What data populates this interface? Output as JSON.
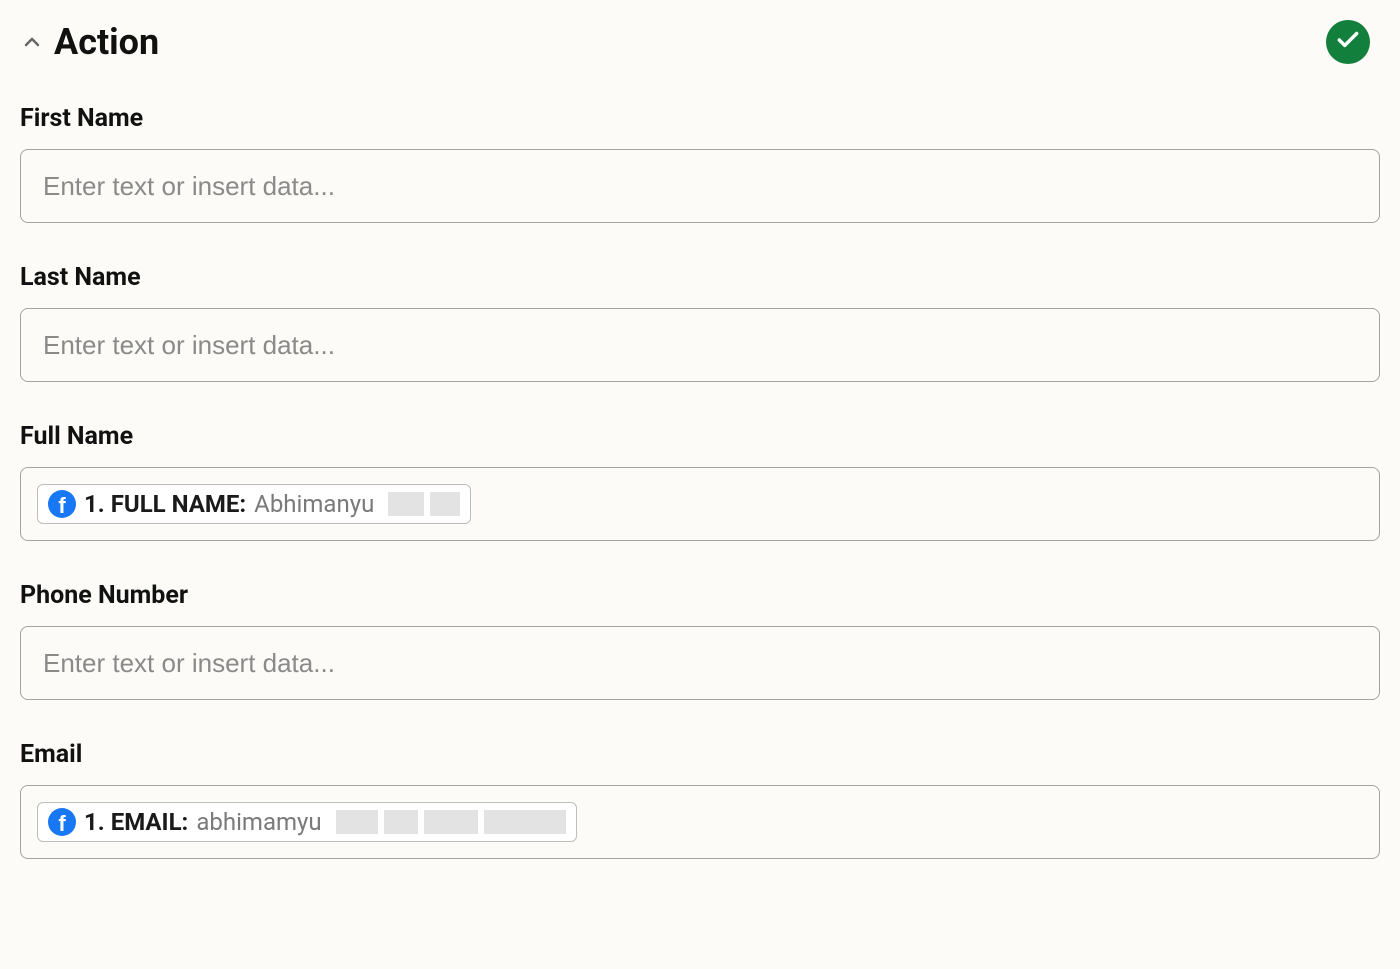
{
  "section": {
    "title": "Action"
  },
  "fields": {
    "first_name": {
      "label": "First Name",
      "placeholder": "Enter text or insert data..."
    },
    "last_name": {
      "label": "Last Name",
      "placeholder": "Enter text or insert data..."
    },
    "full_name": {
      "label": "Full Name",
      "pill": {
        "source_icon": "facebook-icon",
        "label": "1. FULL NAME:",
        "value": "Abhimanyu",
        "redacted_blocks": [
          36,
          30
        ]
      }
    },
    "phone_number": {
      "label": "Phone Number",
      "placeholder": "Enter text or insert data..."
    },
    "email": {
      "label": "Email",
      "pill": {
        "source_icon": "facebook-icon",
        "label": "1. EMAIL:",
        "value": "abhimamyu",
        "redacted_blocks": [
          42,
          34,
          54,
          82
        ]
      }
    }
  },
  "status": {
    "icon": "check-circle-icon",
    "color": "#12803c"
  }
}
